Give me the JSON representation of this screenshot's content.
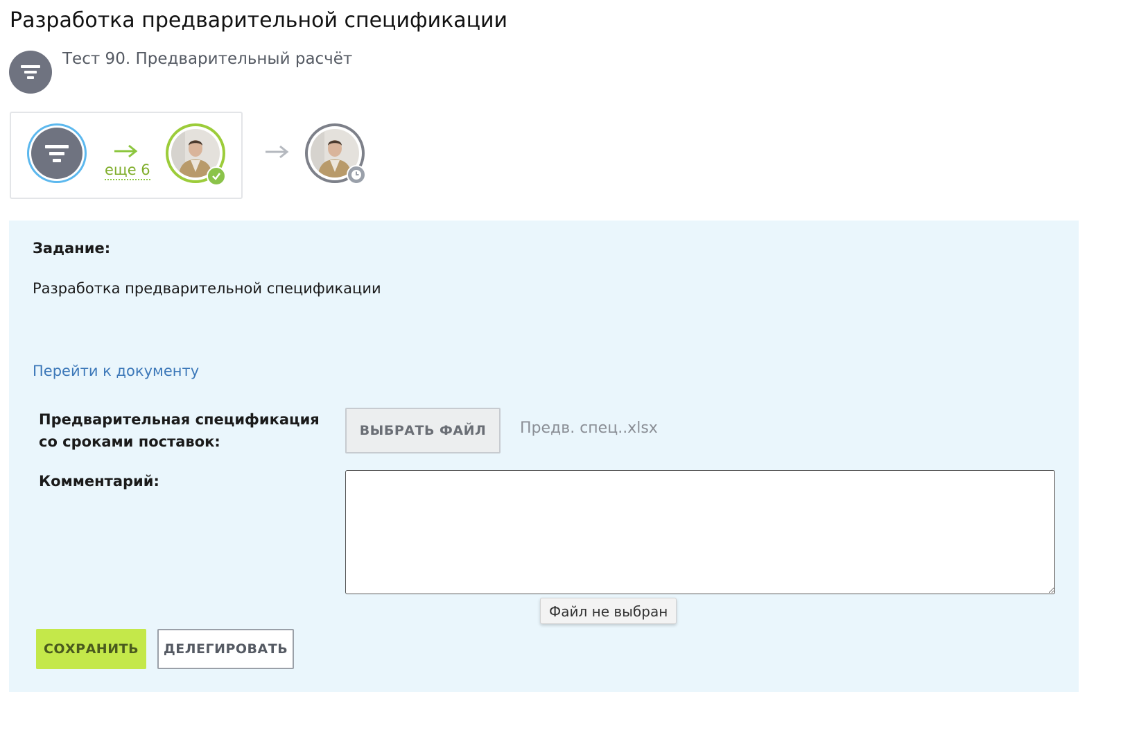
{
  "header": {
    "title": "Разработка предварительной спецификации",
    "process_name": "Тест 90. Предварительный расчёт"
  },
  "route": {
    "more_label": "еще 6",
    "start_icon": "funnel-icon",
    "completed_step_status": "check-icon",
    "pending_step_status": "clock-icon"
  },
  "task": {
    "label": "Задание:",
    "text": "Разработка предварительной спецификации",
    "document_link": "Перейти к документу"
  },
  "form": {
    "file_field_label": "Предварительная спецификация со сроками поставок:",
    "choose_file_label": "ВЫБРАТЬ ФАЙЛ",
    "file_name": "Предв. спец..xlsx",
    "comment_label": "Комментарий:",
    "comment_value": "",
    "tooltip": "Файл не выбран"
  },
  "actions": {
    "save_label": "СОХРАНИТЬ",
    "delegate_label": "ДЕЛЕГИРОВАТЬ"
  },
  "colors": {
    "accent_green": "#c4e84a",
    "link_blue": "#3b77b8",
    "panel_bg": "#eaf6fc",
    "start_ring": "#5cb8ee",
    "done_ring": "#9ccc3a"
  }
}
